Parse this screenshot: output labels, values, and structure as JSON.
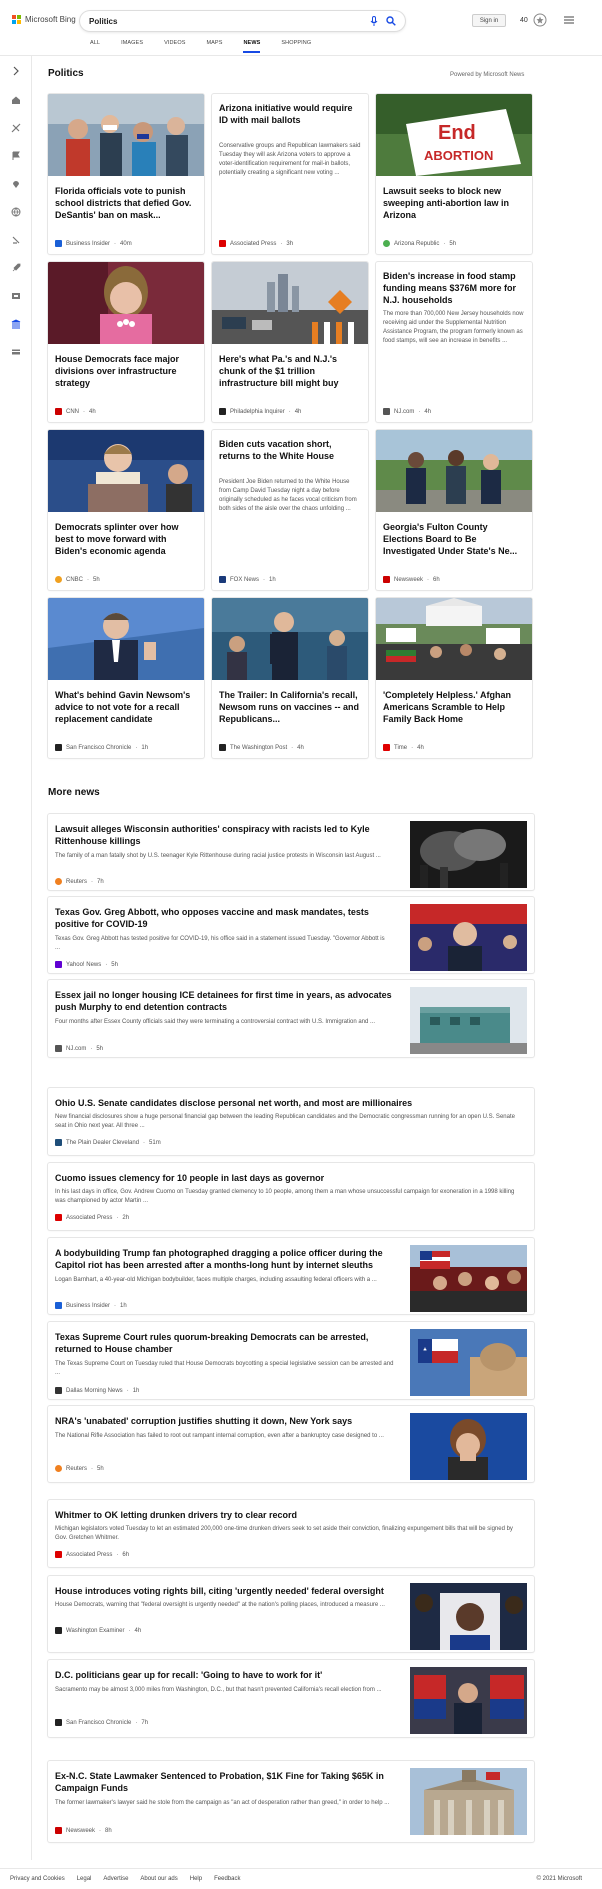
{
  "header": {
    "logo_text": "Microsoft Bing",
    "search_value": "Politics",
    "signin_label": "Sign in",
    "points": "40",
    "tabs": [
      "ALL",
      "IMAGES",
      "VIDEOS",
      "MAPS",
      "NEWS",
      "SHOPPING"
    ],
    "active_tab": "NEWS"
  },
  "main": {
    "section_title": "Politics",
    "powered_by": "Powered by Microsoft News",
    "more_title": "More news"
  },
  "cards": [
    {
      "title": "Florida officials vote to punish school districts that defied Gov. DeSantis' ban on mask...",
      "source": "Business Insider",
      "age": "40m",
      "has_image": true,
      "image": "masked-students",
      "src_color": "#1a5fd6"
    },
    {
      "title": "Arizona initiative would require ID with mail ballots",
      "snippet": "Conservative groups and Republican lawmakers said Tuesday they will ask Arizona voters to approve a voter-identification requirement for mail-in ballots, potentially creating a significant new voting ...",
      "source": "Associated Press",
      "age": "3h",
      "has_image": false,
      "src_color": "#d00"
    },
    {
      "title": "Lawsuit seeks to block new sweeping anti-abortion law in Arizona",
      "source": "Arizona Republic",
      "age": "5h",
      "has_image": true,
      "image": "end-abortion-sign",
      "src_color": "#4caf50"
    },
    {
      "title": "House Democrats face major divisions over infrastructure strategy",
      "source": "CNN",
      "age": "4h",
      "has_image": true,
      "image": "pelosi-pink",
      "src_color": "#cc0000"
    },
    {
      "title": "Here's what Pa.'s and N.J.'s chunk of the $1 trillion infrastructure bill might buy",
      "source": "Philadelphia Inquirer",
      "age": "4h",
      "has_image": true,
      "image": "road-construction",
      "src_color": "#222"
    },
    {
      "title": "Biden's increase in food stamp funding means $376M more for N.J. households",
      "snippet": "The more than 700,000 New Jersey households now receiving aid under the Supplemental Nutrition Assistance Program, the program formerly known as food stamps, will see an increase in benefits ...",
      "source": "NJ.com",
      "age": "4h",
      "has_image": false,
      "src_color": "#555"
    },
    {
      "title": "Democrats splinter over how best to move forward with Biden's economic agenda",
      "source": "CNBC",
      "age": "5h",
      "has_image": true,
      "image": "pelosi-podium",
      "src_color": "#f0a020"
    },
    {
      "title": "Biden cuts vacation short, returns to the White House",
      "snippet": "President Joe Biden returned to the White House from Camp David Tuesday night a day before originally scheduled as he faces vocal criticism from both sides of the aisle over the chaos unfolding ...",
      "source": "FOX News",
      "age": "1h",
      "has_image": false,
      "src_color": "#1a3a7a"
    },
    {
      "title": "Georgia's Fulton County Elections Board to Be Investigated Under State's Ne...",
      "source": "Newsweek",
      "age": "6h",
      "has_image": true,
      "image": "officials-outdoor",
      "src_color": "#cc0000"
    },
    {
      "title": "What's behind Gavin Newsom's advice to not vote for a recall replacement candidate",
      "source": "San Francisco Chronicle",
      "age": "1h",
      "has_image": true,
      "image": "newsom-blue",
      "src_color": "#222"
    },
    {
      "title": "The Trailer: In California's recall, Newsom runs on vaccines -- and Republicans...",
      "source": "The Washington Post",
      "age": "4h",
      "has_image": true,
      "image": "newsom-speaking",
      "src_color": "#222"
    },
    {
      "title": "'Completely Helpless.' Afghan Americans Scramble to Help Family Back Home",
      "source": "Time",
      "age": "4h",
      "has_image": true,
      "image": "protest-whitehouse",
      "src_color": "#e00000"
    }
  ],
  "more_news": [
    {
      "title": "Lawsuit alleges Wisconsin authorities' conspiracy with racists led to Kyle Rittenhouse killings",
      "snippet": "The family of a man fatally shot by U.S. teenager Kyle Rittenhouse during racial justice protests in Wisconsin last August ...",
      "source": "Reuters",
      "age": "7h",
      "has_image": true,
      "image": "night-smoke",
      "src_color": "#f08020"
    },
    {
      "title": "Texas Gov. Greg Abbott, who opposes vaccine and mask mandates, tests positive for COVID-19",
      "snippet": "Texas Gov. Greg Abbott has tested positive for COVID-19, his office said in a statement issued Tuesday. \"Governor Abbott is ...",
      "source": "Yahoo! News",
      "age": "5h",
      "has_image": true,
      "image": "abbott-event",
      "src_color": "#6001d2"
    },
    {
      "title": "Essex jail no longer housing ICE detainees for first time in years, as advocates push Murphy to end detention contracts",
      "snippet": "Four months after Essex County officials said they were terminating a controversial contract with U.S. Immigration and ...",
      "source": "NJ.com",
      "age": "5h",
      "has_image": true,
      "image": "jail-building",
      "src_color": "#555"
    },
    {
      "title": "Ohio U.S. Senate candidates disclose personal net worth, and most are millionaires",
      "snippet": "New financial disclosures show a huge personal financial gap between the leading Republican candidates and the Democratic congressman running for an open U.S. Senate seat in Ohio next year. All three ...",
      "source": "The Plain Dealer Cleveland",
      "age": "51m",
      "has_image": false,
      "src_color": "#1f4e79"
    },
    {
      "title": "Cuomo issues clemency for 10 people in last days as governor",
      "snippet": "In his last days in office, Gov. Andrew Cuomo on Tuesday granted clemency to 10 people, among them a man whose unsuccessful campaign for exoneration in a 1998 killing was championed by actor Martin ...",
      "source": "Associated Press",
      "age": "2h",
      "has_image": false,
      "src_color": "#d00"
    },
    {
      "title": "A bodybuilding Trump fan photographed dragging a police officer during the Capitol riot has been arrested after a months-long hunt by internet sleuths",
      "snippet": "Logan Barnhart, a 40-year-old Michigan bodybuilder, faces multiple charges, including assaulting federal officers with a ...",
      "source": "Business Insider",
      "age": "1h",
      "has_image": true,
      "image": "capitol-crowd",
      "src_color": "#1a5fd6"
    },
    {
      "title": "Texas Supreme Court rules quorum-breaking Democrats can be arrested, returned to House chamber",
      "snippet": "The Texas Supreme Court on Tuesday ruled that House Democrats boycotting a special legislative session can be arrested and ...",
      "source": "Dallas Morning News",
      "age": "1h",
      "has_image": true,
      "image": "texas-capitol",
      "src_color": "#333"
    },
    {
      "title": "NRA's 'unabated' corruption justifies shutting it down, New York says",
      "snippet": "The National Rifle Association has failed to root out rampant internal corruption, even after a bankruptcy case designed to ...",
      "source": "Reuters",
      "age": "5h",
      "has_image": true,
      "image": "woman-blue",
      "src_color": "#f08020"
    },
    {
      "title": "Whitmer to OK letting drunken drivers try to clear record",
      "snippet": "Michigan legislators voted Tuesday to let an estimated 200,000 one-time drunken drivers seek to set aside their conviction, finalizing expungement bills that will be signed by Gov. Gretchen Whitmer.",
      "source": "Associated Press",
      "age": "6h",
      "has_image": false,
      "src_color": "#d00"
    },
    {
      "title": "House introduces voting rights bill, citing 'urgently needed' federal oversight",
      "snippet": "House Democrats, warning that \"federal oversight is urgently needed\" at the nation's polling places, introduced a measure ...",
      "source": "Washington Examiner",
      "age": "4h",
      "has_image": true,
      "image": "lewis-shirt",
      "src_color": "#222"
    },
    {
      "title": "D.C. politicians gear up for recall: 'Going to have to work for it'",
      "snippet": "Sacramento may be almost 3,000 miles from Washington, D.C., but that hasn't prevented California's recall election from ...",
      "source": "San Francisco Chronicle",
      "age": "7h",
      "has_image": true,
      "image": "recall-signs",
      "src_color": "#222"
    },
    {
      "title": "Ex-N.C. State Lawmaker Sentenced to Probation, $1K Fine for Taking $65K in Campaign Funds",
      "snippet": "The former lawmaker's lawyer said he stole from the campaign as \"an act of desperation rather than greed,\" in order to help ...",
      "source": "Newsweek",
      "age": "8h",
      "has_image": true,
      "image": "nc-building",
      "src_color": "#cc0000"
    }
  ],
  "footer": {
    "links": [
      "Privacy and Cookies",
      "Legal",
      "Advertise",
      "About our ads",
      "Help",
      "Feedback"
    ],
    "copyright": "© 2021 Microsoft"
  }
}
